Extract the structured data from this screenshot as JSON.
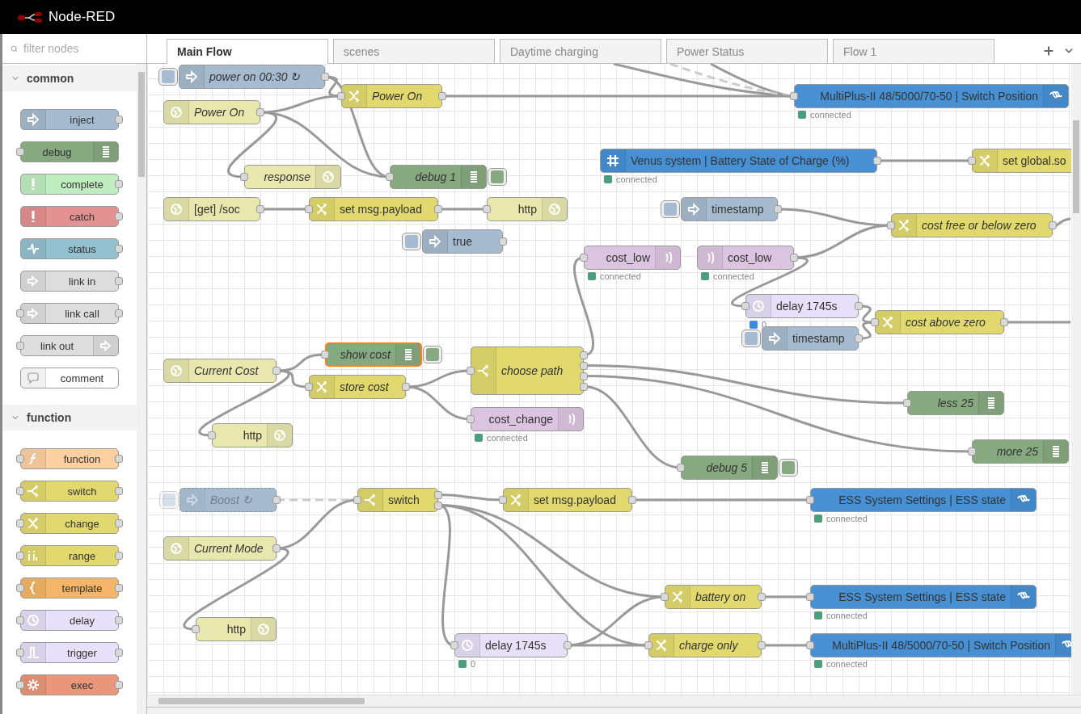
{
  "header": {
    "title": "Node-RED"
  },
  "palette": {
    "filter": {
      "placeholder": "filter nodes"
    },
    "categories": [
      {
        "name": "common",
        "expanded": true,
        "items": [
          {
            "label": "inject",
            "kind": "inject",
            "color": "#a6bbcf"
          },
          {
            "label": "debug",
            "kind": "debug",
            "color": "#87a980"
          },
          {
            "label": "complete",
            "kind": "complete",
            "color": "#c0edc0"
          },
          {
            "label": "catch",
            "kind": "catch",
            "color": "#e49191"
          },
          {
            "label": "status",
            "kind": "status",
            "color": "#94c1d0"
          },
          {
            "label": "link in",
            "kind": "link-in",
            "color": "#dddddd"
          },
          {
            "label": "link call",
            "kind": "link-call",
            "color": "#dddddd"
          },
          {
            "label": "link out",
            "kind": "link-out",
            "color": "#dddddd"
          },
          {
            "label": "comment",
            "kind": "comment",
            "color": "#ffffff"
          }
        ]
      },
      {
        "name": "function",
        "expanded": true,
        "items": [
          {
            "label": "function",
            "kind": "function",
            "color": "#fdd0a2"
          },
          {
            "label": "switch",
            "kind": "switch",
            "color": "#e2d96e"
          },
          {
            "label": "change",
            "kind": "change",
            "color": "#e2d96e"
          },
          {
            "label": "range",
            "kind": "range",
            "color": "#e2d96e"
          },
          {
            "label": "template",
            "kind": "template",
            "color": "#f3b567"
          },
          {
            "label": "delay",
            "kind": "delay",
            "color": "#e6e0f8"
          },
          {
            "label": "trigger",
            "kind": "trigger",
            "color": "#e6e0f8"
          },
          {
            "label": "exec",
            "kind": "exec",
            "color": "#e9967a"
          }
        ]
      }
    ]
  },
  "tabs": [
    {
      "label": "Main Flow",
      "selected": true
    },
    {
      "label": "scenes",
      "selected": false
    },
    {
      "label": "Daytime charging",
      "selected": false
    },
    {
      "label": "Power Status",
      "selected": false
    },
    {
      "label": "Flow 1",
      "selected": false
    }
  ],
  "nodes": [
    {
      "label": "power on 00:30 ↻",
      "kind": "inject",
      "color": "#a6bbcf",
      "italic": true,
      "selected": false,
      "disabled": false
    },
    {
      "label": "Power On",
      "kind": "http-in",
      "color": "#e7e7ae",
      "italic": true,
      "selected": false,
      "disabled": false
    },
    {
      "label": "Power On",
      "kind": "change",
      "color": "#e2d96e",
      "italic": true,
      "selected": false,
      "disabled": false
    },
    {
      "label": "MultiPlus-II 48/5000/70-50 | Switch Position",
      "kind": "victron-out",
      "color": "#4790d4",
      "italic": false,
      "selected": false,
      "disabled": false,
      "status": {
        "text": "connected",
        "color": "#4c9e7d"
      }
    },
    {
      "label": "response",
      "kind": "http-response",
      "color": "#e7e7ae",
      "italic": true,
      "selected": false,
      "disabled": false
    },
    {
      "label": "debug 1",
      "kind": "debug",
      "color": "#87a980",
      "italic": true,
      "selected": false,
      "disabled": false,
      "active": true
    },
    {
      "label": "Venus system | Battery State of Charge (%)",
      "kind": "victron-in",
      "color": "#4790d4",
      "italic": false,
      "selected": false,
      "disabled": false,
      "status": {
        "text": "connected",
        "color": "#4c9e7d"
      }
    },
    {
      "label": "set global.so",
      "kind": "change",
      "color": "#e2d96e",
      "italic": false,
      "selected": false,
      "disabled": false
    },
    {
      "label": "[get] /soc",
      "kind": "http-in",
      "color": "#e7e7ae",
      "italic": false,
      "selected": false,
      "disabled": false
    },
    {
      "label": "set msg.payload",
      "kind": "change",
      "color": "#e2d96e",
      "italic": false,
      "selected": false,
      "disabled": false
    },
    {
      "label": "http",
      "kind": "http-response",
      "color": "#e7e7ae",
      "italic": false,
      "selected": false,
      "disabled": false
    },
    {
      "label": "timestamp",
      "kind": "inject",
      "color": "#a6bbcf",
      "italic": false,
      "selected": false,
      "disabled": false
    },
    {
      "label": "true",
      "kind": "inject",
      "color": "#a6bbcf",
      "italic": false,
      "selected": false,
      "disabled": false
    },
    {
      "label": "cost free or below zero",
      "kind": "change",
      "color": "#e2d96e",
      "italic": true,
      "selected": false,
      "disabled": false
    },
    {
      "label": "cost_low",
      "kind": "signal-out",
      "color": "#dbc4e0",
      "italic": false,
      "selected": false,
      "disabled": false,
      "status": {
        "text": "connected",
        "color": "#4c9e7d"
      }
    },
    {
      "label": "cost_low",
      "kind": "signal-in",
      "color": "#dbc4e0",
      "italic": false,
      "selected": false,
      "disabled": false,
      "status": {
        "text": "connected",
        "color": "#4c9e7d"
      }
    },
    {
      "label": "delay 1745s",
      "kind": "delay",
      "color": "#e6e0f8",
      "italic": false,
      "selected": false,
      "disabled": false,
      "status": {
        "text": "0",
        "color": "#3b8be0"
      }
    },
    {
      "label": "timestamp",
      "kind": "inject",
      "color": "#a6bbcf",
      "italic": false,
      "selected": false,
      "disabled": false
    },
    {
      "label": "cost above zero",
      "kind": "change",
      "color": "#e2d96e",
      "italic": true,
      "selected": false,
      "disabled": false
    },
    {
      "label": "Current Cost",
      "kind": "http-in",
      "color": "#e7e7ae",
      "italic": true,
      "selected": false,
      "disabled": false
    },
    {
      "label": "show cost",
      "kind": "debug",
      "color": "#87a980",
      "italic": true,
      "selected": true,
      "disabled": false,
      "active": true
    },
    {
      "label": "store cost",
      "kind": "change",
      "color": "#e2d96e",
      "italic": true,
      "selected": false,
      "disabled": false
    },
    {
      "label": "choose path",
      "kind": "switch",
      "color": "#e2d96e",
      "italic": true,
      "selected": false,
      "disabled": false
    },
    {
      "label": "less 25",
      "kind": "debug",
      "color": "#87a980",
      "italic": true,
      "selected": false,
      "disabled": false
    },
    {
      "label": "http",
      "kind": "http-response",
      "color": "#e7e7ae",
      "italic": false,
      "selected": false,
      "disabled": false
    },
    {
      "label": "cost_change",
      "kind": "signal-out",
      "color": "#dbc4e0",
      "italic": false,
      "selected": false,
      "disabled": false,
      "status": {
        "text": "connected",
        "color": "#4c9e7d"
      }
    },
    {
      "label": "debug 5",
      "kind": "debug",
      "color": "#87a980",
      "italic": true,
      "selected": false,
      "disabled": false,
      "active": true
    },
    {
      "label": "more 25",
      "kind": "debug",
      "color": "#87a980",
      "italic": true,
      "selected": false,
      "disabled": false
    },
    {
      "label": "Boost ↻",
      "kind": "inject",
      "color": "#a6bbcf",
      "italic": true,
      "selected": false,
      "disabled": true
    },
    {
      "label": "switch",
      "kind": "switch",
      "color": "#e2d96e",
      "italic": false,
      "selected": false,
      "disabled": false
    },
    {
      "label": "set msg.payload",
      "kind": "change",
      "color": "#e2d96e",
      "italic": false,
      "selected": false,
      "disabled": false
    },
    {
      "label": "ESS System Settings | ESS state",
      "kind": "victron-out",
      "color": "#4790d4",
      "italic": false,
      "selected": false,
      "disabled": false,
      "status": {
        "text": "connected",
        "color": "#4c9e7d"
      }
    },
    {
      "label": "Current Mode",
      "kind": "http-in",
      "color": "#e7e7ae",
      "italic": true,
      "selected": false,
      "disabled": false
    },
    {
      "label": "battery on",
      "kind": "change",
      "color": "#e2d96e",
      "italic": true,
      "selected": false,
      "disabled": false
    },
    {
      "label": "ESS System Settings | ESS state",
      "kind": "victron-out",
      "color": "#4790d4",
      "italic": false,
      "selected": false,
      "disabled": false,
      "status": {
        "text": "connected",
        "color": "#4c9e7d"
      }
    },
    {
      "label": "http",
      "kind": "http-response",
      "color": "#e7e7ae",
      "italic": false,
      "selected": false,
      "disabled": false
    },
    {
      "label": "delay 1745s",
      "kind": "delay",
      "color": "#e6e0f8",
      "italic": false,
      "selected": false,
      "disabled": false,
      "status": {
        "text": "0",
        "color": "#4c9e7d"
      }
    },
    {
      "label": "charge only",
      "kind": "change",
      "color": "#e2d96e",
      "italic": true,
      "selected": false,
      "disabled": false
    },
    {
      "label": "MultiPlus-II 48/5000/70-50 | Switch Position",
      "kind": "victron-out",
      "color": "#4790d4",
      "italic": false,
      "selected": false,
      "disabled": false,
      "status": {
        "text": "connected",
        "color": "#4c9e7d"
      }
    }
  ]
}
